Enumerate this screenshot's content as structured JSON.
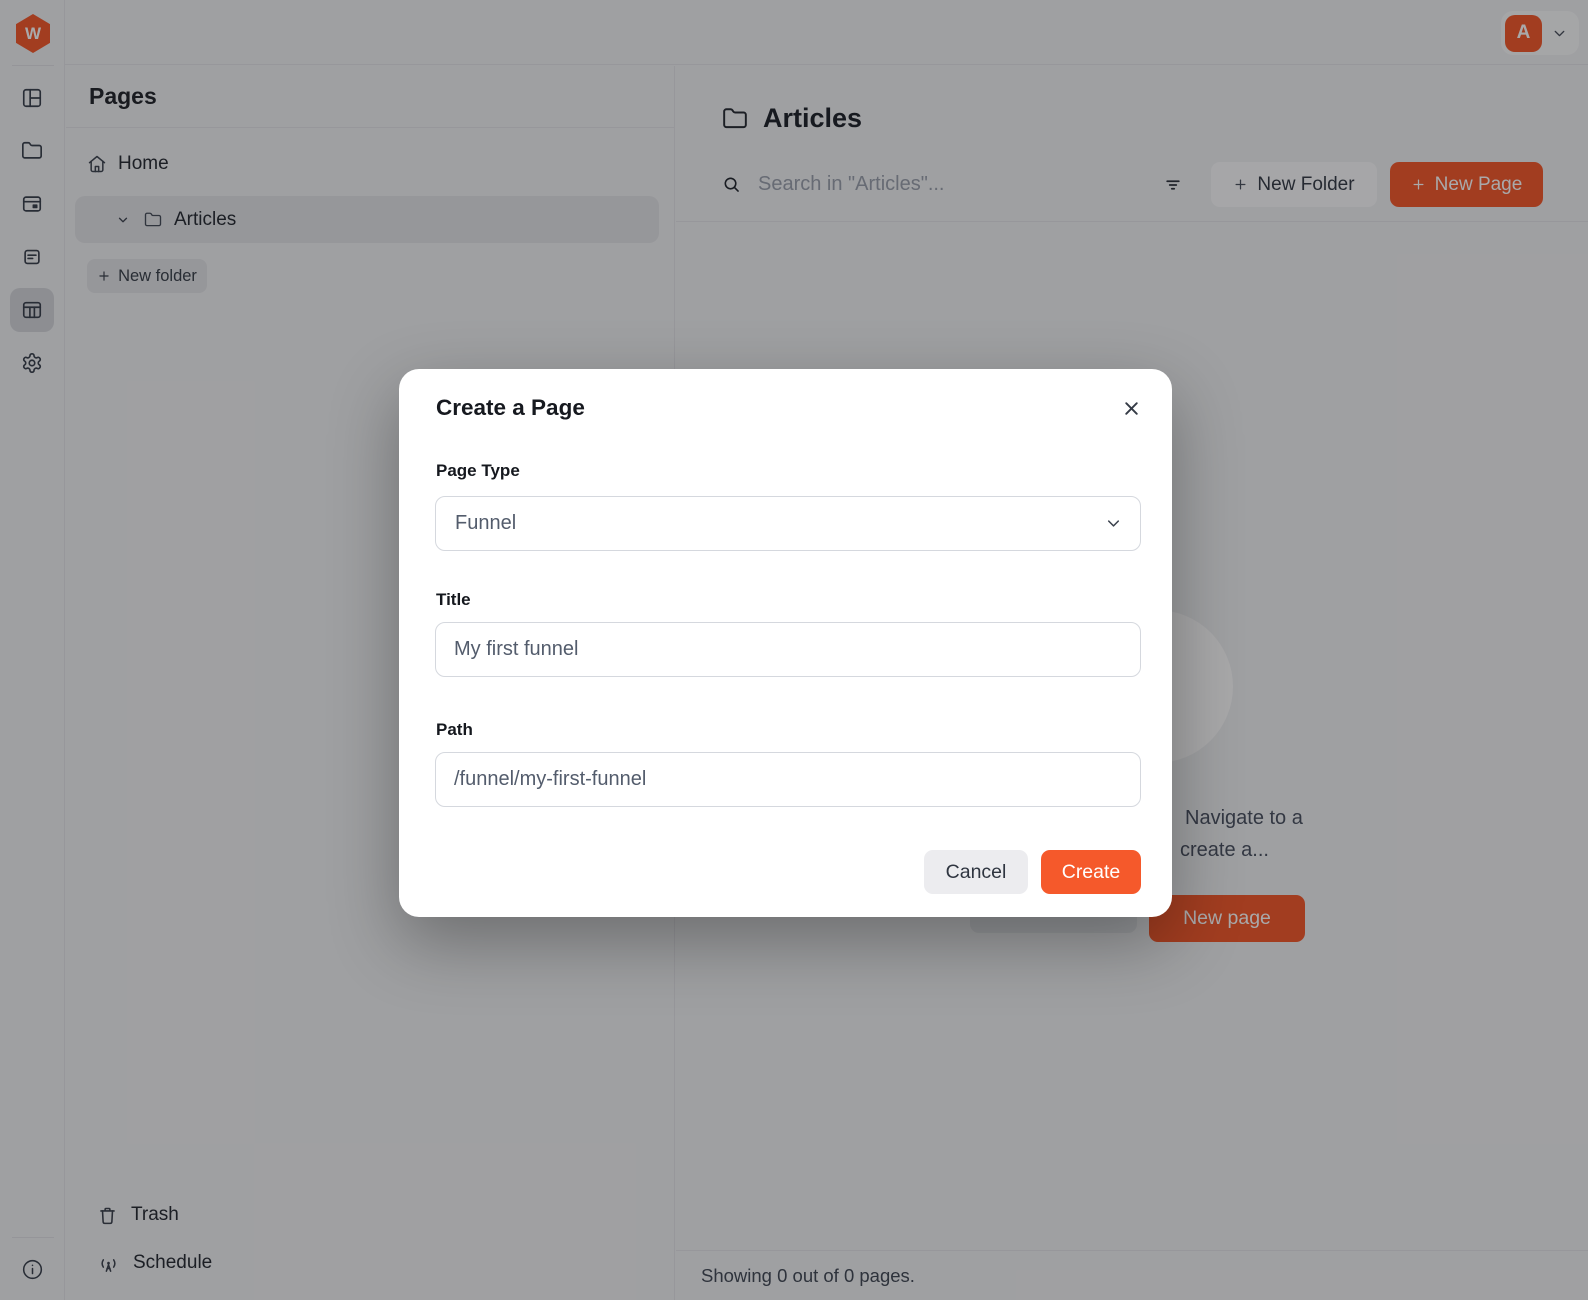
{
  "window": {
    "logo_letter": "W",
    "avatar_initial": "A"
  },
  "colors": {
    "primary": "#f5592b",
    "overlay": "rgba(10,10,12,0.35)"
  },
  "pages_panel": {
    "title": "Pages",
    "home_label": "Home",
    "articles_label": "Articles",
    "new_folder_label": "New folder",
    "trash_label": "Trash",
    "schedule_label": "Schedule"
  },
  "header": {
    "title": "Articles",
    "search_placeholder": "Search in \"Articles\"...",
    "new_folder_button": "New Folder",
    "new_page_button": "New Page"
  },
  "empty_state": {
    "line1": "Navigate to a",
    "line2": "create a...",
    "new_page_button": "New page"
  },
  "footer": {
    "status": "Showing 0 out of 0 pages."
  },
  "modal": {
    "title": "Create a Page",
    "page_type_label": "Page Type",
    "page_type_value": "Funnel",
    "title_label": "Title",
    "title_value": "My first funnel",
    "path_label": "Path",
    "path_value": "/funnel/my-first-funnel",
    "cancel_label": "Cancel",
    "create_label": "Create"
  }
}
